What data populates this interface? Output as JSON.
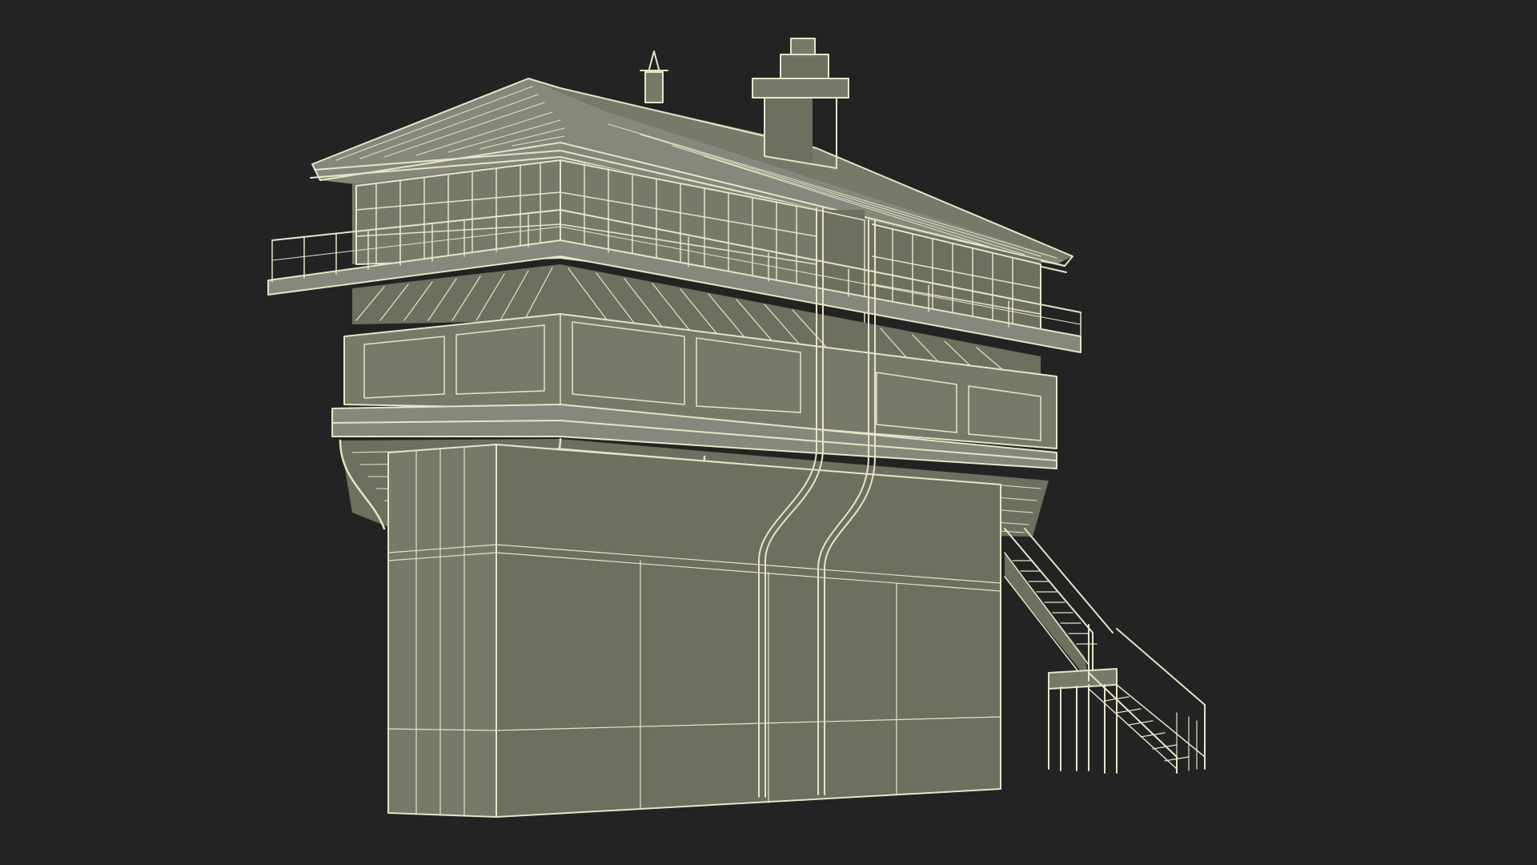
{
  "scene": {
    "subject": "",
    "colors": {
      "background": "#232323",
      "wireframe": "#e7e4c8",
      "surface_dark": "#6d6f5f",
      "surface_mid": "#777a69",
      "surface_light": "#85887a"
    }
  }
}
